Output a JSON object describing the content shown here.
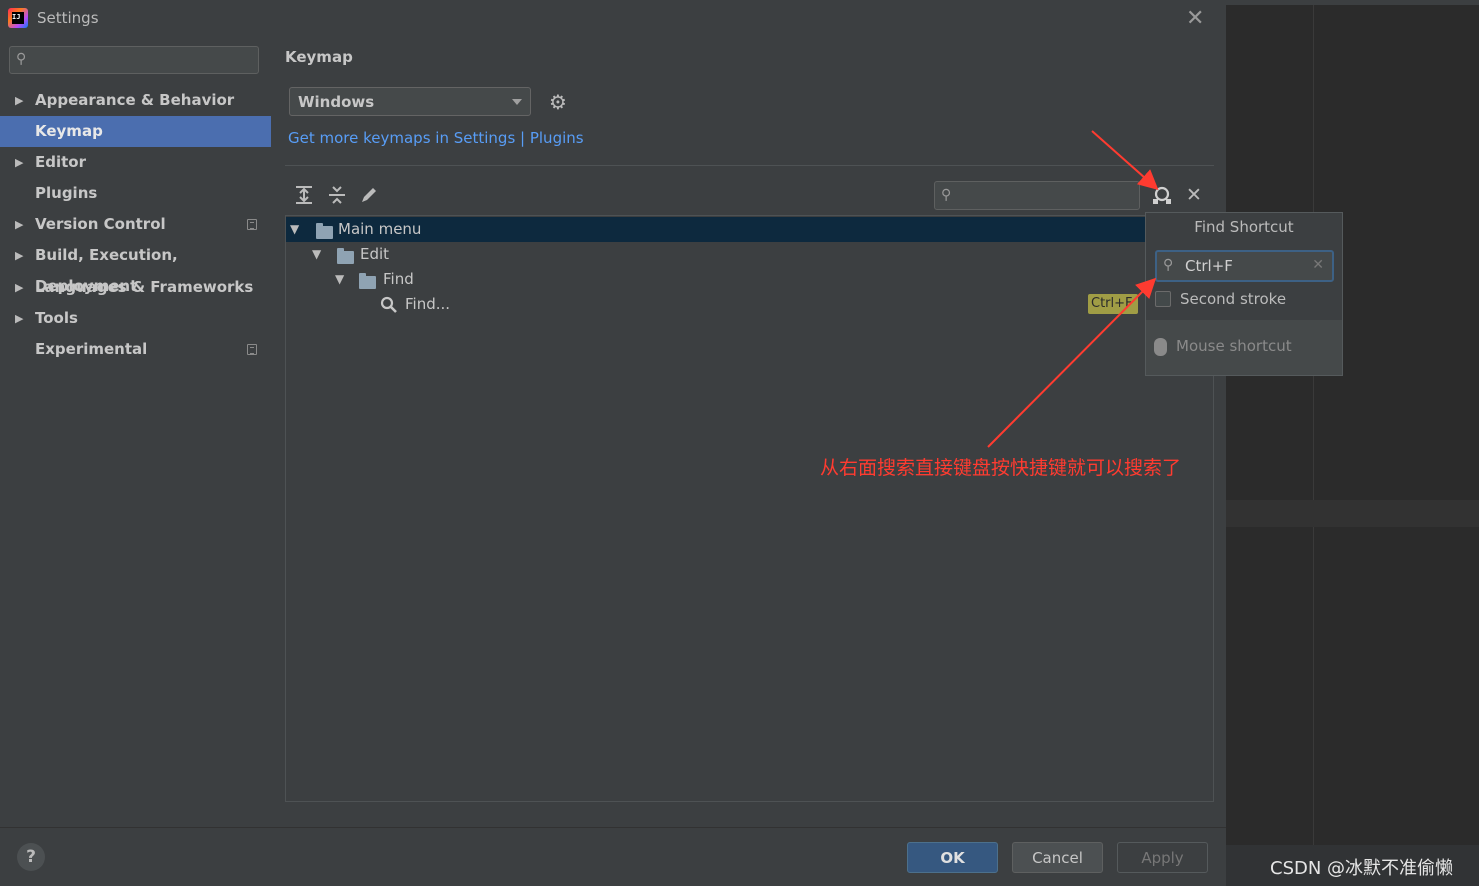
{
  "window": {
    "title": "Settings",
    "close_glyph": "✕"
  },
  "sidebar": {
    "search_placeholder": "",
    "items": [
      {
        "label": "Appearance & Behavior",
        "expandable": true
      },
      {
        "label": "Keymap",
        "selected": true
      },
      {
        "label": "Editor",
        "expandable": true
      },
      {
        "label": "Plugins"
      },
      {
        "label": "Version Control",
        "expandable": true
      },
      {
        "label": "Build, Execution, Deployment",
        "expandable": true
      },
      {
        "label": "Languages & Frameworks",
        "expandable": true
      },
      {
        "label": "Tools",
        "expandable": true
      },
      {
        "label": "Experimental"
      }
    ]
  },
  "content": {
    "title": "Keymap",
    "keymap_value": "Windows",
    "plugins_link": "Get more keymaps in Settings | Plugins",
    "tree_search_value": ""
  },
  "tree": {
    "rows": [
      {
        "label": "Main menu"
      },
      {
        "label": "Edit"
      },
      {
        "label": "Find"
      },
      {
        "label": "Find...",
        "shortcut": "Ctrl+F"
      }
    ]
  },
  "popup": {
    "title": "Find Shortcut",
    "input_value": "Ctrl+F",
    "second_stroke_label": "Second stroke",
    "second_stroke_checked": false,
    "mouse_shortcut_label": "Mouse shortcut"
  },
  "annotation": {
    "text": "从右面搜索直接键盘按快捷键就可以搜索了",
    "color": "#ff3b30"
  },
  "footer": {
    "help_label": "?",
    "ok_label": "OK",
    "cancel_label": "Cancel",
    "apply_label": "Apply"
  },
  "watermark": "CSDN @冰默不准偷懒",
  "colors": {
    "dialog_bg": "#3c3f41",
    "selection": "#4b6eaf",
    "tree_selection": "#0d293e",
    "link": "#589df6",
    "shortcut_badge": "#a09d45"
  }
}
